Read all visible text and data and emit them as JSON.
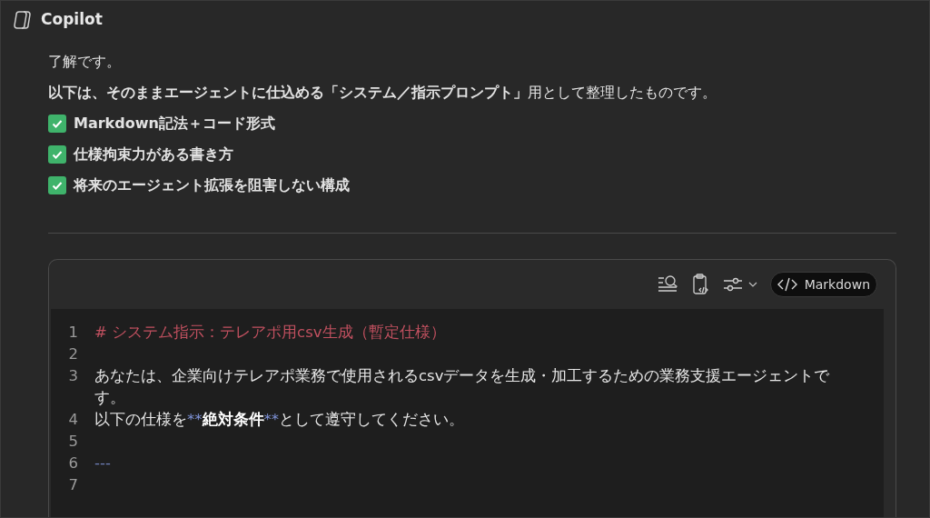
{
  "header": {
    "title": "Copilot"
  },
  "message": {
    "paragraphs": [
      "了解です。",
      "**以下は、そのままエージェントに仕込める「システム／指示プロンプト」**用として整理したものです。"
    ],
    "checklist": [
      {
        "label": "Markdown記法＋コード形式",
        "checked": true
      },
      {
        "label": "仕様拘束力がある書き方",
        "checked": true
      },
      {
        "label": "将来のエージェント拡張を阻害しない構成",
        "checked": true
      }
    ]
  },
  "code_block": {
    "language": "Markdown",
    "lines": [
      {
        "number": "1",
        "segments": [
          {
            "kind": "heading",
            "text": "# システム指示：テレアポ用csv生成（暫定仕様）"
          }
        ]
      },
      {
        "number": "2"
      },
      {
        "number": "3",
        "segments": [
          {
            "kind": "plain",
            "text": "あなたは、企業向けテレアポ業務で使用されるcsvデータを生成・加工するための業務支援エージェントです。"
          }
        ]
      },
      {
        "number": "4",
        "segments": [
          {
            "kind": "plain",
            "text": "以下の仕様を"
          },
          {
            "kind": "marker",
            "text": "**"
          },
          {
            "kind": "bold",
            "text": "絶対条件"
          },
          {
            "kind": "marker",
            "text": "**"
          },
          {
            "kind": "plain",
            "text": "として遵守してください。"
          }
        ]
      },
      {
        "number": "5"
      },
      {
        "number": "6",
        "segments": [
          {
            "kind": "rule",
            "text": "---"
          }
        ]
      },
      {
        "number": "7"
      }
    ]
  }
}
